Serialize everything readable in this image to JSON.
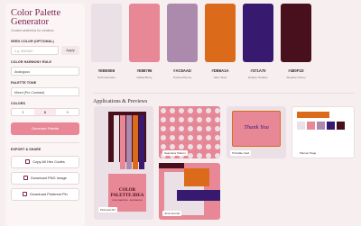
{
  "app": {
    "title": "Color Palette Generator",
    "subtitle": "Curated aesthetics for creatives"
  },
  "seed": {
    "label": "SEED COLOR (OPTIONAL)",
    "placeholder": "e.g. #f59483",
    "apply": "Apply"
  },
  "harmony": {
    "label": "COLOR HARMONY RULE",
    "value": "Analogous"
  },
  "tone": {
    "label": "PALETTE TONE",
    "value": "Mixed (Pro Contrast)"
  },
  "colors_count": {
    "label": "COLORS",
    "options": [
      "3",
      "6",
      "9"
    ],
    "selected": "6"
  },
  "generate": "Generate Palette",
  "export": {
    "label": "EXPORT & SHARE",
    "copy": "Copy All Hex Codes",
    "png": "Download PNG Image",
    "pin": "Download Pinterest Pin"
  },
  "palette": [
    {
      "hex": "#EBE0E6",
      "name": "Soft Carnation"
    },
    {
      "hex": "#E88796",
      "name": "Gilded Berry"
    },
    {
      "hex": "#AC8AAD",
      "name": "Hushed Peony"
    },
    {
      "hex": "#DB6A1A",
      "name": "Siren Rust"
    },
    {
      "hex": "#371A70",
      "name": "Eclipse Heather"
    },
    {
      "hex": "#480F1D",
      "name": "Shadow Cherry"
    }
  ],
  "previews": {
    "title": "Applications & Previews",
    "pin_label": "Pinterest Pin",
    "pin_title": "COLOR PALETTE IDEA",
    "pin_sub": "FOR CREATIVES · INSPIRATION",
    "seamless": "Seamless Pattern",
    "card": "Printable Card",
    "card_text": "Thank You",
    "planner": "Planner Page",
    "journal": "Junk Journal"
  }
}
